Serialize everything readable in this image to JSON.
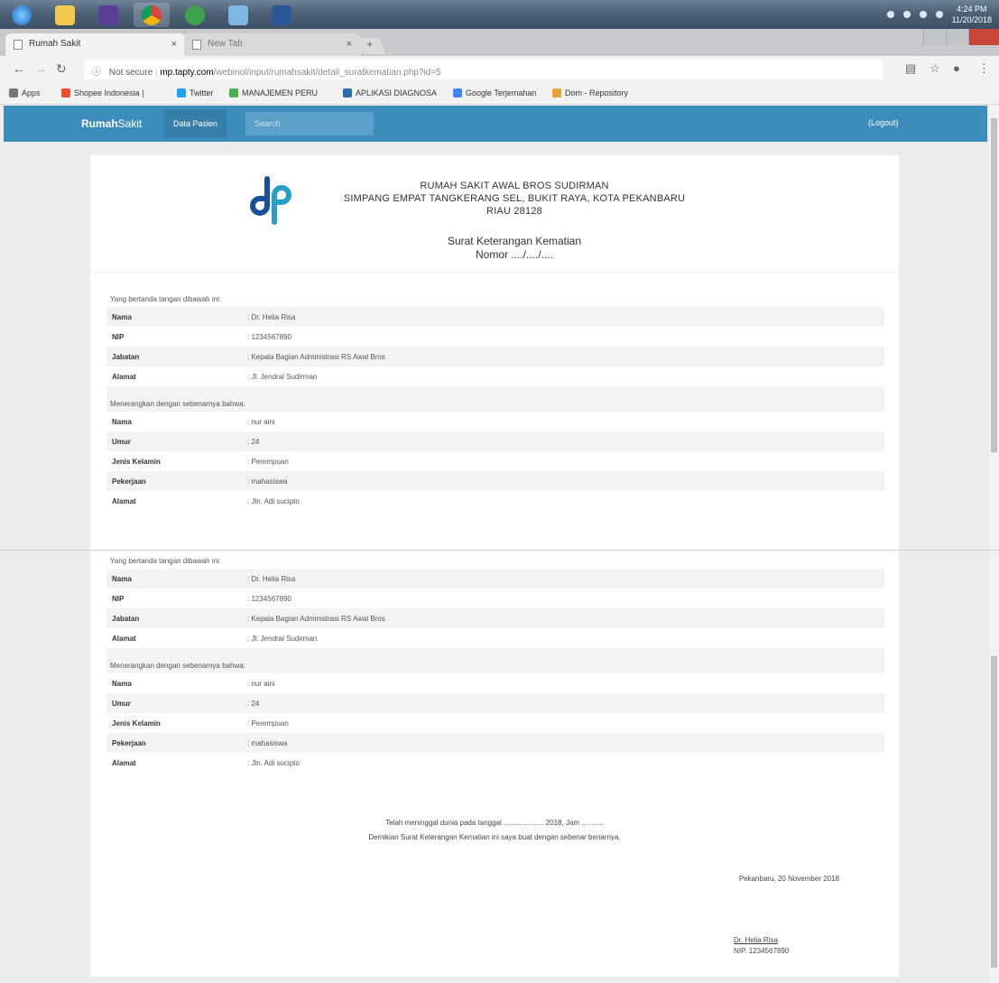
{
  "taskbar": {
    "clock_time": "4:24 PM",
    "clock_date": "11/20/2018"
  },
  "browser": {
    "tabs": [
      {
        "label": "Rumah Sakit",
        "active": true
      },
      {
        "label": "New Tab",
        "active": false
      }
    ],
    "address": {
      "security_label": "Not secure",
      "host": "mp.tapty.com",
      "path": "/webinol/input/rumahsakit/detail_suratkematian.php?id=5"
    },
    "bookmarks": [
      {
        "label": "Apps",
        "color": "#777777"
      },
      {
        "label": "Shopee Indonesia |",
        "color": "#ee4d2d"
      },
      {
        "label": "Twitter",
        "color": "#1da1f2"
      },
      {
        "label": "MANAJEMEN PERU",
        "color": "#4caf50"
      },
      {
        "label": "APLIKASI DIAGNOSA",
        "color": "#2a6db0"
      },
      {
        "label": "Google Terjemahan",
        "color": "#4285f4"
      },
      {
        "label": "Dom - Repository",
        "color": "#e8a33d"
      }
    ]
  },
  "app": {
    "brand_bold": "Rumah",
    "brand_light": "Sakit",
    "nav_item": "Data Pasien",
    "search_placeholder": "Search",
    "logout_label": "(Logout)",
    "accent_color": "#3c8dbc"
  },
  "letter": {
    "hospital_name": "RUMAH SAKIT AWAL BROS SUDIRMAN",
    "address_line": "SIMPANG EMPAT TANGKERANG SEL, BUKIT RAYA, KOTA PEKANBARU",
    "postal_line": "RIAU 28128",
    "title": "Surat Keterangan Kematian",
    "number": "Nomor ..../..../....",
    "records": [
      {
        "signer_intro": "Yang bertanda tangan dibawah ini:",
        "signer": [
          {
            "label": "Nama",
            "value": ": Dr. Helia Risa"
          },
          {
            "label": "NIP",
            "value": ": 1234567890"
          },
          {
            "label": "Jabatan",
            "value": ": Kepala Bagian Administrasi RS Awal Bros"
          },
          {
            "label": "Alamat",
            "value": ": Jl. Jendral Sudirman"
          }
        ],
        "subject_intro": "Menerangkan dengan sebenarnya bahwa:",
        "subject": [
          {
            "label": "Nama",
            "value": ": nur aini"
          },
          {
            "label": "Umur",
            "value": ": 24"
          },
          {
            "label": "Jenis Kelamin",
            "value": ": Perempuan"
          },
          {
            "label": "Pekerjaan",
            "value": ": mahasiswa"
          },
          {
            "label": "Alamat",
            "value": ": Jln. Adi sucipto"
          }
        ]
      },
      {
        "signer_intro": "Yang bertanda tangan dibawah ini:",
        "signer": [
          {
            "label": "Nama",
            "value": ": Dr. Helia Risa"
          },
          {
            "label": "NIP",
            "value": ": 1234567890"
          },
          {
            "label": "Jabatan",
            "value": ": Kepala Bagian Administrasi RS Awal Bros"
          },
          {
            "label": "Alamat",
            "value": ": Jl. Jendral Sudirman"
          }
        ],
        "subject_intro": "Menerangkan dengan sebenarnya bahwa:",
        "subject": [
          {
            "label": "Nama",
            "value": ": nur aini"
          },
          {
            "label": "Umur",
            "value": ": 24"
          },
          {
            "label": "Jenis Kelamin",
            "value": ": Perempuan"
          },
          {
            "label": "Pekerjaan",
            "value": ": mahasiswa"
          },
          {
            "label": "Alamat",
            "value": ": Jln. Adi sucipto"
          }
        ]
      }
    ],
    "closing_line1": "Telah meninggal dunia pada tanggal .................... 2018, Jam ...........",
    "closing_line2": "Demikian Surat Keterangan Kematian ini saya buat dengan sebenar benarnya.",
    "place_date": "Pekanbaru, 20 November 2018",
    "signature_name": "Dr. Helia Risa",
    "signature_nip": "NIP. 1234567890"
  }
}
